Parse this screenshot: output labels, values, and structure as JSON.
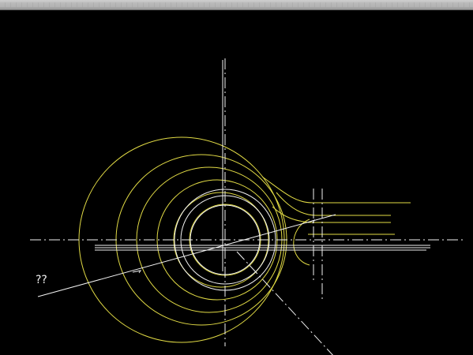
{
  "window": {
    "title": ""
  },
  "canvas": {
    "annotation": "??",
    "background": "#000000",
    "colors": {
      "primary": "#e2db45",
      "secondary": "#f2f2f2"
    }
  }
}
